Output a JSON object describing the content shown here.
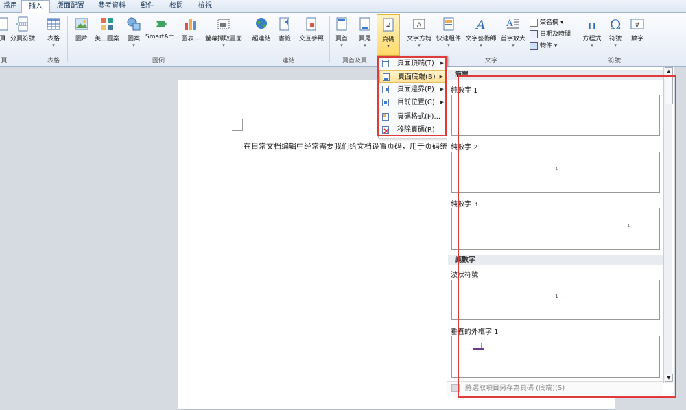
{
  "tabs": [
    "常用",
    "插入",
    "版面配置",
    "參考資料",
    "郵件",
    "校閱",
    "檢視"
  ],
  "active_tab": "插入",
  "ribbon": {
    "buttons": {
      "page": "頁",
      "page_break": "分頁符號",
      "table": "表格",
      "picture": "圖片",
      "clipart": "美工圖案",
      "shapes": "圖案",
      "smartart": "SmartArt...",
      "chart": "圖表...",
      "screenshot": "螢幕擷取畫面",
      "hyperlink": "超連結",
      "bookmark": "書籤",
      "crossref": "交互參照",
      "header": "頁首",
      "footer": "頁尾",
      "pagenum": "頁碼",
      "textbox": "文字方塊",
      "quickparts": "快速組件",
      "wordart": "文字藝術師",
      "dropcap": "首字放大",
      "signature": "簽名欄",
      "datetime": "日期及時間",
      "object": "物件",
      "equation": "方程式",
      "symbol": "符號",
      "number": "數字"
    },
    "groups": {
      "pages": "頁",
      "tables": "表格",
      "illustrations": "圖例",
      "links": "連結",
      "headerfooter": "頁首及頁",
      "text": "文字",
      "symbols": "符號"
    }
  },
  "document": {
    "text": "在日常文档编辑中经常需要我们给文档设置页码，用于页码统"
  },
  "menu": {
    "items": [
      "頁面頂端(T)",
      "頁面底端(B)",
      "頁面邊界(P)",
      "目前位置(C)",
      "頁碼格式(F)...",
      "移除頁碼(R)"
    ]
  },
  "gallery": {
    "section1": "簡單",
    "section2": "純數字",
    "items": [
      {
        "title": "純數字 1",
        "sample": "1"
      },
      {
        "title": "純數字 2",
        "sample": "1"
      },
      {
        "title": "純數字 3",
        "sample": "1"
      },
      {
        "title": "波狀符號",
        "sample": "~ 1 ~"
      },
      {
        "title": "垂直的外框字 1",
        "sample": ""
      }
    ],
    "footer": "將選取項目另存為頁碼 (底端)(S)"
  },
  "colors": {
    "highlight": "#e03b3b",
    "active_button": "#ffd96a"
  }
}
